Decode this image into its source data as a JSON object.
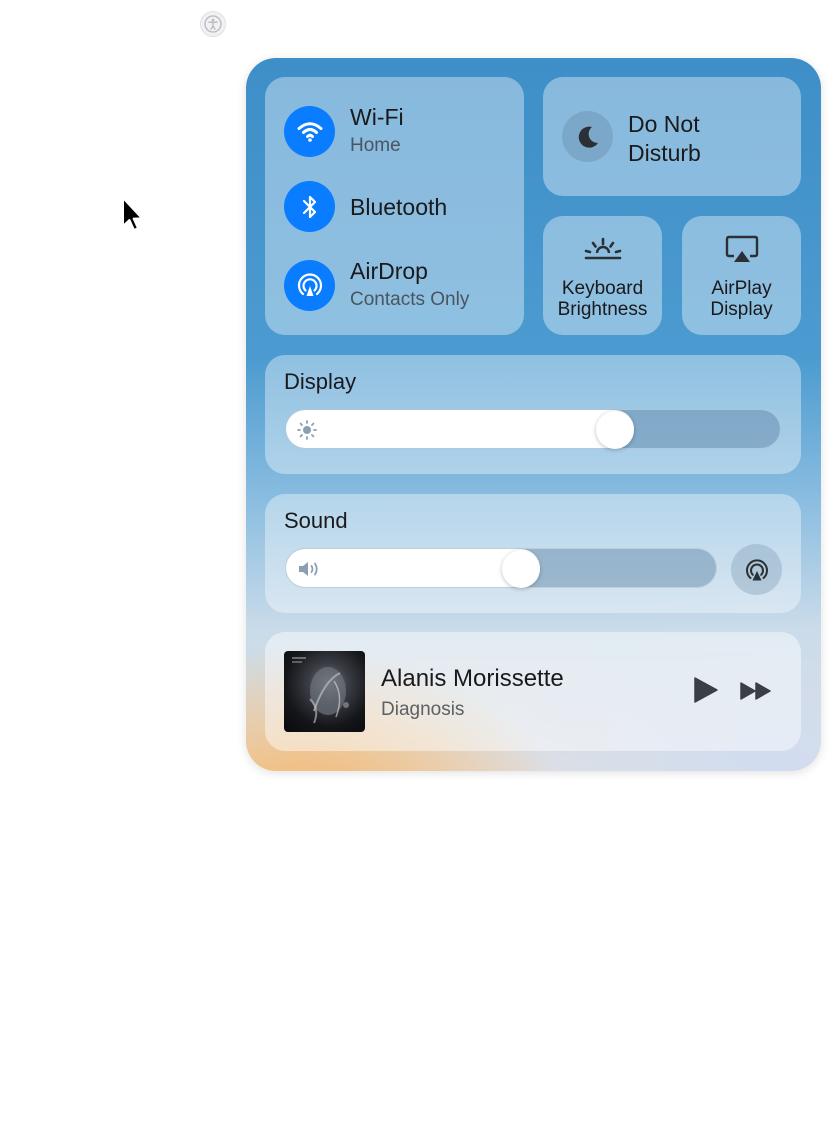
{
  "control_center": {
    "connectivity": {
      "wifi": {
        "label": "Wi-Fi",
        "status": "Home"
      },
      "bluetooth": {
        "label": "Bluetooth"
      },
      "airdrop": {
        "label": "AirDrop",
        "status": "Contacts Only"
      }
    },
    "do_not_disturb": {
      "label_line1": "Do Not",
      "label_line2": "Disturb"
    },
    "keyboard_brightness": {
      "label_line1": "Keyboard",
      "label_line2": "Brightness"
    },
    "airplay_display": {
      "label_line1": "AirPlay",
      "label_line2": "Display"
    },
    "display": {
      "title": "Display",
      "brightness_level": 0.68
    },
    "sound": {
      "title": "Sound",
      "volume_level": 0.55
    },
    "now_playing": {
      "artist": "Alanis Morissette",
      "track": "Diagnosis"
    }
  },
  "icons": {
    "accessibility": "accessibility-icon",
    "wifi": "wifi-icon",
    "bluetooth": "bluetooth-icon",
    "airdrop": "airdrop-icon",
    "moon": "moon-icon",
    "keyboard_brightness": "keyboard-brightness-icon",
    "airplay_display": "airplay-display-icon",
    "sun": "sun-icon",
    "speaker": "speaker-icon",
    "airplay_audio": "airplay-audio-icon",
    "play": "play-icon",
    "fast_forward": "fast-forward-icon"
  },
  "colors": {
    "accent_blue": "#0a7cff",
    "panel_top": "#3e8ec8",
    "panel_bottom_glow": "#f3bd7c"
  }
}
